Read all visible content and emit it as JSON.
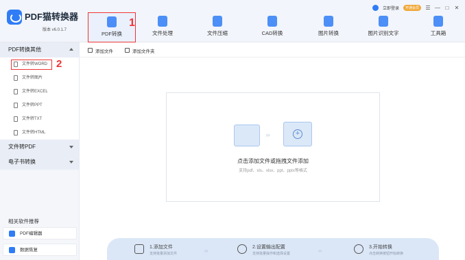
{
  "app": {
    "title": "PDF猫转换器",
    "version": "版本 v6.0.1.7"
  },
  "topbar": {
    "login": "立即登录",
    "badge": "开通会员",
    "menu_icon": "menu-icon",
    "minimize": "—",
    "maximize": "□",
    "close": "✕"
  },
  "nav": {
    "items": [
      {
        "label": "PDF转换",
        "icon": "pdf-convert-icon",
        "active": true
      },
      {
        "label": "文件处理",
        "icon": "file-process-icon"
      },
      {
        "label": "文件压缩",
        "icon": "compress-icon"
      },
      {
        "label": "CAD转换",
        "icon": "cad-icon"
      },
      {
        "label": "图片转换",
        "icon": "image-icon"
      },
      {
        "label": "图片识别文字",
        "icon": "ocr-icon"
      },
      {
        "label": "工具箱",
        "icon": "toolbox-icon"
      }
    ]
  },
  "annotations": {
    "one": "1",
    "two": "2"
  },
  "sidebar": {
    "group1": "PDF转换其他",
    "items": [
      {
        "label": "文件转WORD",
        "active": true
      },
      {
        "label": "文件转图片"
      },
      {
        "label": "文件转EXCEL"
      },
      {
        "label": "文件转PPT"
      },
      {
        "label": "文件转TXT"
      },
      {
        "label": "文件转HTML"
      }
    ],
    "group2": "文件转PDF",
    "group3": "电子书转换",
    "recommend_title": "相关软件推荐",
    "recommend": [
      {
        "label": "PDF编辑器"
      },
      {
        "label": "数据恢复"
      }
    ]
  },
  "toolbar": {
    "add_file": "添加文件",
    "add_folder": "添加文件夹"
  },
  "dropzone": {
    "title": "点击添加文件或拖拽文件添加",
    "subtitle": "支持pdf、xls、xlsx、ppt、pptx等格式",
    "arrows": "›››"
  },
  "steps": [
    {
      "title": "1.添加文件",
      "desc": "支持批量添加文件"
    },
    {
      "title": "2.设置输出配置",
      "desc": "支持批量操作和选择设置"
    },
    {
      "title": "3.开始转换",
      "desc": "点击转换按钮开始转换"
    }
  ],
  "colors": {
    "accent": "#2f7cf6",
    "annotation": "#ee3333"
  }
}
